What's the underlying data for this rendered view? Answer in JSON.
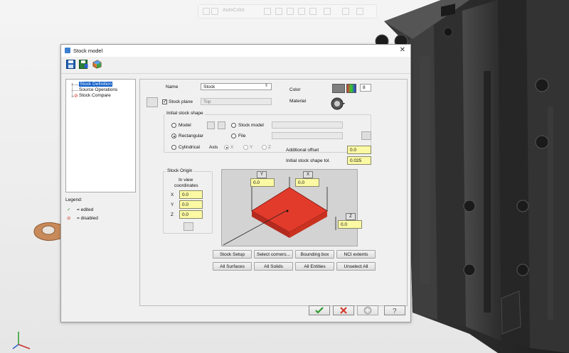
{
  "top_toolbar": {
    "text": "AutoColor"
  },
  "dialog": {
    "title": "Stock model",
    "tree": {
      "items": [
        {
          "label": "Stock Definition",
          "selected": true
        },
        {
          "label": "Source Operations",
          "selected": false
        },
        {
          "label": "Stock Compare",
          "selected": false
        }
      ]
    },
    "legend": {
      "title": "Legend:",
      "items": [
        {
          "icon": "check-icon",
          "label": "= edited"
        },
        {
          "icon": "disabled-icon",
          "label": "= disabled"
        }
      ]
    },
    "name_label": "Name",
    "name_value": "Stock",
    "stock_plane_label": "Stock plane",
    "stock_plane_checked": true,
    "stock_plane_value": "Top",
    "color_label": "Color",
    "color_value": "8",
    "material_label": "Material",
    "initial_shape": {
      "title": "Initial stock shape",
      "model_label": "Model",
      "stock_model_label": "Stock model",
      "rectangular_label": "Rectangular",
      "file_label": "File",
      "cylindrical_label": "Cylindrical",
      "axis_label": "Axis",
      "axis_x": "X",
      "axis_y": "Y",
      "axis_z": "Z",
      "selected": "Rectangular"
    },
    "additional_offset_label": "Additional offset",
    "additional_offset_value": "0.0",
    "shape_tol_label": "Initial stock shape tol.",
    "shape_tol_value": "0.025",
    "origin": {
      "title": "Stock Origin",
      "subtitle_1": "In view",
      "subtitle_2": "coordinates",
      "x_label": "X",
      "x_value": "0.0",
      "y_label": "Y",
      "y_value": "0.0",
      "z_label": "Z",
      "z_value": "0.0"
    },
    "preview": {
      "y_tag": "Y",
      "y_value": "0.0",
      "x_tag": "X",
      "x_value": "0.0",
      "z_tag": "Z",
      "z_value": "0.0",
      "block_color": "#e23b2c"
    },
    "buttons_row1": [
      "Stock Setup",
      "Select corners...",
      "Bounding box",
      "NCI extents"
    ],
    "buttons_row2": [
      "All Surfaces",
      "All Solids",
      "All Entities",
      "Unselect All"
    ],
    "colors": {
      "color_swatch": "#7f7f7f",
      "ok_green": "#2e9a2e",
      "cancel_red": "#d43a2a"
    }
  }
}
